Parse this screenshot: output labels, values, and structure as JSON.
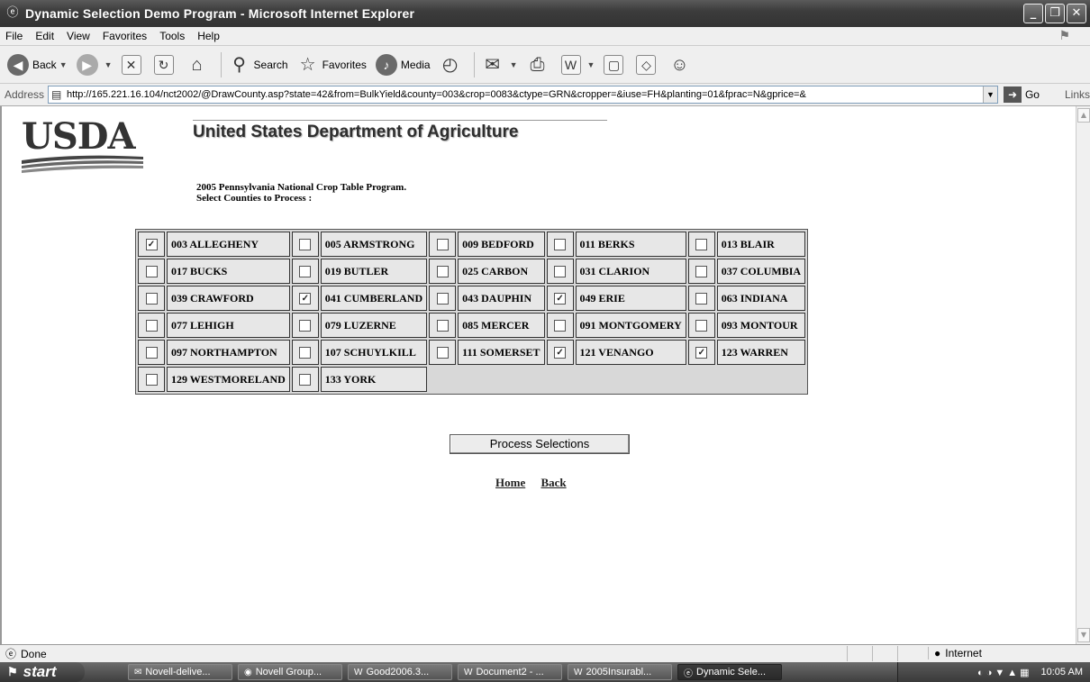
{
  "window": {
    "title": "Dynamic Selection Demo Program - Microsoft Internet Explorer",
    "controls": [
      "_",
      "❐",
      "✕"
    ]
  },
  "menu": [
    "File",
    "Edit",
    "View",
    "Favorites",
    "Tools",
    "Help"
  ],
  "toolbar": {
    "back": "Back",
    "search": "Search",
    "favorites": "Favorites",
    "media": "Media"
  },
  "address": {
    "label": "Address",
    "url": "http://165.221.16.104/nct2002/@DrawCounty.asp?state=42&from=BulkYield&county=003&crop=0083&ctype=GRN&cropper=&iuse=FH&planting=01&fprac=N&gprice=&",
    "go": "Go",
    "links": "Links"
  },
  "page": {
    "logo_text": "USDA",
    "heading": "United States Department of Agriculture",
    "subtitle_line1": "2005 Pennsylvania National Crop Table Program.",
    "subtitle_line2": "Select Counties to Process :",
    "process_button": "Process Selections",
    "home_link": "Home",
    "back_link": "Back"
  },
  "counties": [
    [
      {
        "label": "003 ALLEGHENY",
        "checked": true
      },
      {
        "label": "005 ARMSTRONG",
        "checked": false
      },
      {
        "label": "009 BEDFORD",
        "checked": false
      },
      {
        "label": "011 BERKS",
        "checked": false
      },
      {
        "label": "013 BLAIR",
        "checked": false
      }
    ],
    [
      {
        "label": "017 BUCKS",
        "checked": false
      },
      {
        "label": "019 BUTLER",
        "checked": false
      },
      {
        "label": "025 CARBON",
        "checked": false
      },
      {
        "label": "031 CLARION",
        "checked": false
      },
      {
        "label": "037 COLUMBIA",
        "checked": false
      }
    ],
    [
      {
        "label": "039 CRAWFORD",
        "checked": false
      },
      {
        "label": "041 CUMBERLAND",
        "checked": true
      },
      {
        "label": "043 DAUPHIN",
        "checked": false
      },
      {
        "label": "049 ERIE",
        "checked": true
      },
      {
        "label": "063 INDIANA",
        "checked": false
      }
    ],
    [
      {
        "label": "077 LEHIGH",
        "checked": false
      },
      {
        "label": "079 LUZERNE",
        "checked": false
      },
      {
        "label": "085 MERCER",
        "checked": false
      },
      {
        "label": "091 MONTGOMERY",
        "checked": false
      },
      {
        "label": "093 MONTOUR",
        "checked": false
      }
    ],
    [
      {
        "label": "097 NORTHAMPTON",
        "checked": false
      },
      {
        "label": "107 SCHUYLKILL",
        "checked": false
      },
      {
        "label": "111 SOMERSET",
        "checked": false
      },
      {
        "label": "121 VENANGO",
        "checked": true
      },
      {
        "label": "123 WARREN",
        "checked": true
      }
    ],
    [
      {
        "label": "129 WESTMORELAND",
        "checked": false
      },
      {
        "label": "133 YORK",
        "checked": false
      }
    ]
  ],
  "status": {
    "text": "Done",
    "zone": "Internet"
  },
  "taskbar": {
    "start": "start",
    "tasks": [
      "Novell-delive...",
      "Novell Group...",
      "Good2006.3...",
      "Document2 - ...",
      "2005Insurabl...",
      "Dynamic Sele..."
    ],
    "clock": "10:05 AM"
  }
}
